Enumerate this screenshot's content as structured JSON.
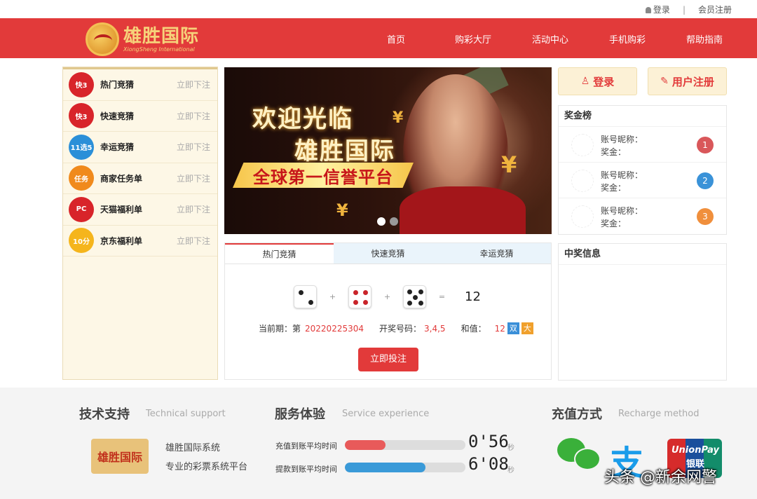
{
  "topbar": {
    "login": "登录",
    "register": "会员注册"
  },
  "logo": {
    "cn": "雄胜国际",
    "en": "XiongSheng International"
  },
  "nav": [
    "首页",
    "购彩大厅",
    "活动中心",
    "手机购彩",
    "帮助指南"
  ],
  "sidebar": {
    "items": [
      {
        "name": "热门竞猜",
        "action": "立即下注",
        "color": "#d8242a",
        "icon_text": "快3"
      },
      {
        "name": "快速竞猜",
        "action": "立即下注",
        "color": "#d8242a",
        "icon_text": "快3"
      },
      {
        "name": "幸运竞猜",
        "action": "立即下注",
        "color": "#2b8fd8",
        "icon_text": "11选5"
      },
      {
        "name": "商家任务单",
        "action": "立即下注",
        "color": "#f08a1c",
        "icon_text": "任务"
      },
      {
        "name": "天猫福利单",
        "action": "立即下注",
        "color": "#d8242a",
        "icon_text": "PC"
      },
      {
        "name": "京东福利单",
        "action": "立即下注",
        "color": "#f5b51c",
        "icon_text": "10分"
      }
    ]
  },
  "banner": {
    "line1": "欢迎光临",
    "line2": "雄胜国际",
    "ribbon": "全球第一信誉平台",
    "active_slide": 1,
    "slide_count": 2
  },
  "panel": {
    "tabs": [
      "热门竞猜",
      "快速竞猜",
      "幸运竞猜"
    ],
    "active_tab": 0,
    "dice": [
      2,
      4,
      5
    ],
    "plus": "+",
    "equals": "=",
    "sum": "12",
    "period_label": "当前期：第",
    "period": "20220225304",
    "numbers_label": "开奖号码：",
    "numbers": "3,4,5",
    "sum_label": "和值：",
    "sum_value": "12",
    "badge_even": "双",
    "badge_big": "大",
    "bet_button": "立即投注"
  },
  "auth": {
    "login": "登录",
    "register": "用户注册"
  },
  "leaderboard": {
    "title": "奖金榜",
    "rows": [
      {
        "nick_label": "账号昵称：",
        "prize_label": "奖金：",
        "rank": "1",
        "color": "#d9575a"
      },
      {
        "nick_label": "账号昵称：",
        "prize_label": "奖金：",
        "rank": "2",
        "color": "#3a92d8"
      },
      {
        "nick_label": "账号昵称：",
        "prize_label": "奖金：",
        "rank": "3",
        "color": "#f08f3c"
      }
    ]
  },
  "news": {
    "title": "中奖信息"
  },
  "footer": {
    "support_title": "技术支持",
    "support_sub": "Technical support",
    "support_logo": "雄胜国际",
    "support_line1": "雄胜国际系统",
    "support_line2": "专业的彩票系统平台",
    "service_title": "服务体验",
    "service_sub": "Service experience",
    "deposit_label": "充值到账平均时间",
    "deposit_value": "0'56",
    "deposit_progress": 0.34,
    "withdraw_label": "提款到账平均时间",
    "withdraw_value": "6'08",
    "withdraw_progress": 0.67,
    "unit": "秒",
    "recharge_title": "充值方式",
    "recharge_sub": "Recharge method",
    "alipay_glyph": "支",
    "unionpay_en": "UnionPay",
    "unionpay_cn": "银联"
  },
  "watermark": "头条 @新余网警",
  "colors": {
    "brand_red": "#e23a3a",
    "deposit_bar": "#e85a5a",
    "withdraw_bar": "#3a9ad8",
    "badge_even": "#3a8fd8",
    "badge_big": "#f0a02c"
  }
}
